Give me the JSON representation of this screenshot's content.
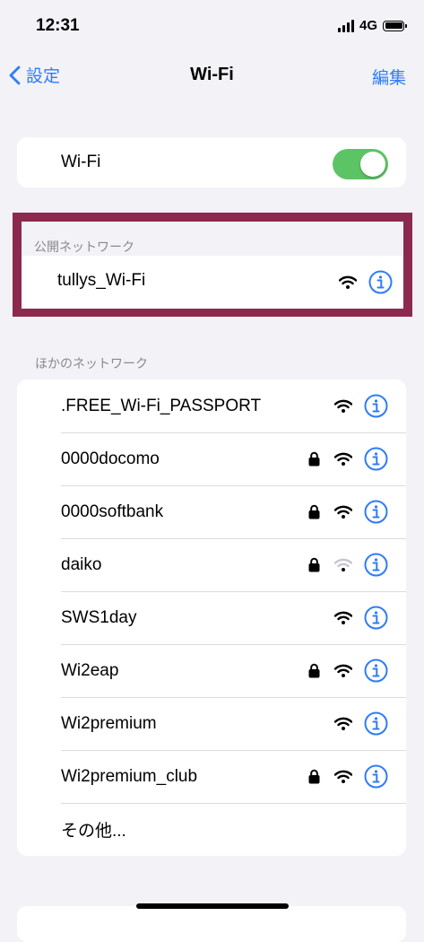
{
  "status_bar": {
    "time": "12:31",
    "network": "4G"
  },
  "nav": {
    "back_label": "設定",
    "title": "Wi-Fi",
    "edit_label": "編集"
  },
  "wifi_toggle": {
    "label": "Wi-Fi",
    "on": true
  },
  "public_networks": {
    "header": "公開ネットワーク",
    "items": [
      {
        "name": "tullys_Wi-Fi",
        "locked": false,
        "signal": "full"
      }
    ]
  },
  "other_networks": {
    "header": "ほかのネットワーク",
    "items": [
      {
        "name": ".FREE_Wi-Fi_PASSPORT",
        "locked": false,
        "signal": "full"
      },
      {
        "name": "0000docomo",
        "locked": true,
        "signal": "full"
      },
      {
        "name": "0000softbank",
        "locked": true,
        "signal": "full"
      },
      {
        "name": "daiko",
        "locked": true,
        "signal": "weak"
      },
      {
        "name": "SWS1day",
        "locked": false,
        "signal": "full"
      },
      {
        "name": "Wi2eap",
        "locked": true,
        "signal": "full"
      },
      {
        "name": "Wi2premium",
        "locked": false,
        "signal": "full"
      },
      {
        "name": "Wi2premium_club",
        "locked": true,
        "signal": "full"
      }
    ],
    "other_label": "その他..."
  },
  "colors": {
    "accent": "#2f7cf6",
    "toggle_on": "#5dc466",
    "highlight": "#8c2a4d",
    "background": "#f2f2f7"
  }
}
